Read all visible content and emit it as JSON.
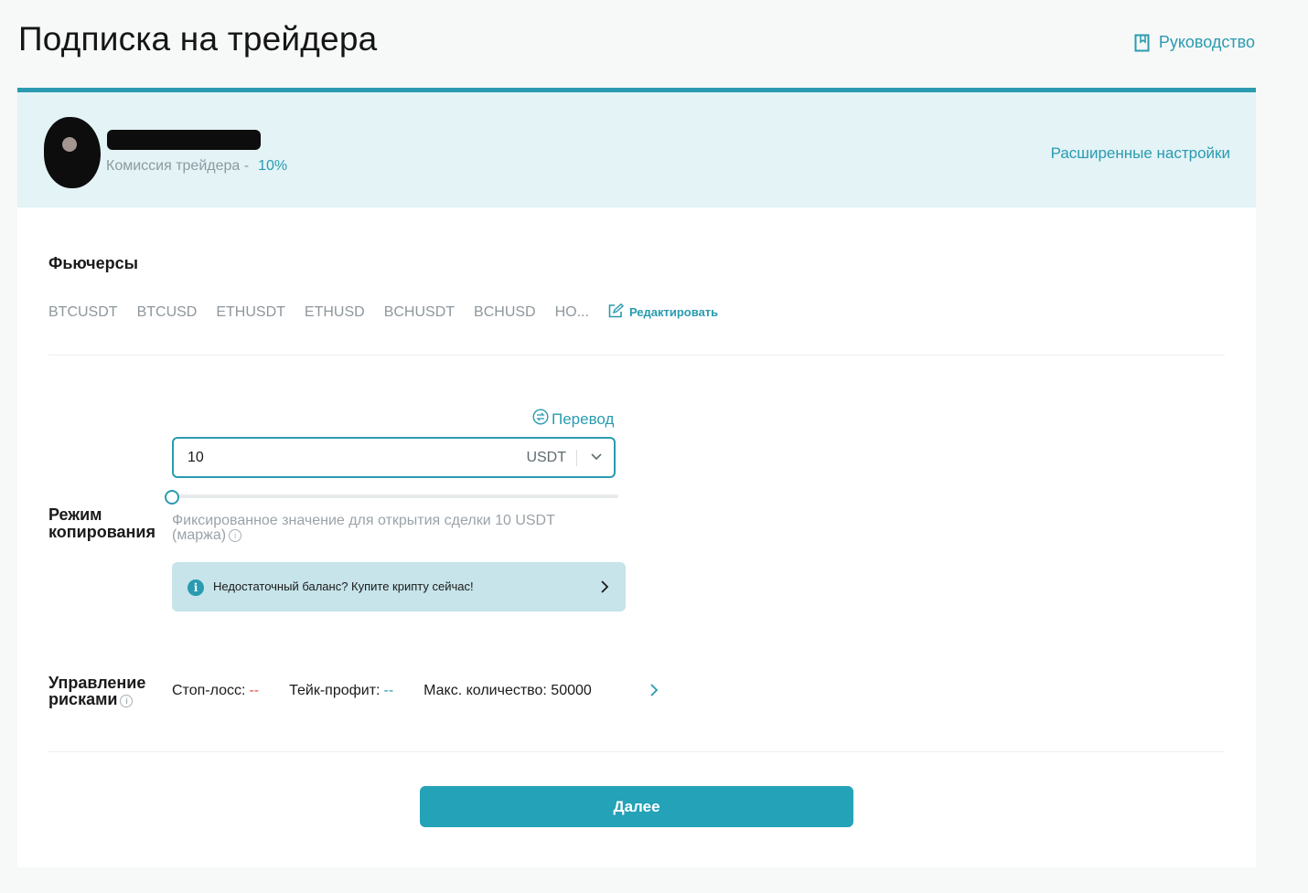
{
  "header": {
    "title": "Подписка на трейдера",
    "guide_label": "Руководство"
  },
  "trader": {
    "commission_label": "Комиссия трейдера -",
    "commission_value": "10%",
    "advanced_settings_label": "Расширенные настройки"
  },
  "futures": {
    "title": "Фьючерсы",
    "pairs": [
      "BTCUSDT",
      "BTCUSD",
      "ETHUSDT",
      "ETHUSD",
      "BCHUSDT",
      "BCHUSD",
      "HO..."
    ],
    "edit_label": "Редактировать"
  },
  "copy_mode": {
    "label_line1": "Режим",
    "label_line2": "копирования",
    "transfer_label": "Перевод",
    "amount_value": "10",
    "amount_unit": "USDT",
    "slider_fraction": 0,
    "hint_line1": "Фиксированное значение для открытия сделки 10 USDT",
    "hint_line2": "(маржа)",
    "banner_text": "Недостаточный баланс? Купите крипту сейчас!"
  },
  "risk": {
    "label_line1": "Управление",
    "label_line2": "рисками",
    "stop_loss_label": "Стоп-лосс:",
    "stop_loss_value": "--",
    "take_profit_label": "Тейк-профит:",
    "take_profit_value": "--",
    "max_qty_label": "Макс. количество: 50000"
  },
  "actions": {
    "next_label": "Далее"
  },
  "colors": {
    "accent": "#2a9bb0",
    "button": "#24a2b8",
    "banner_bg": "#c6e4ea",
    "header_bg": "#e3f3f6",
    "negative": "#e14d43"
  }
}
